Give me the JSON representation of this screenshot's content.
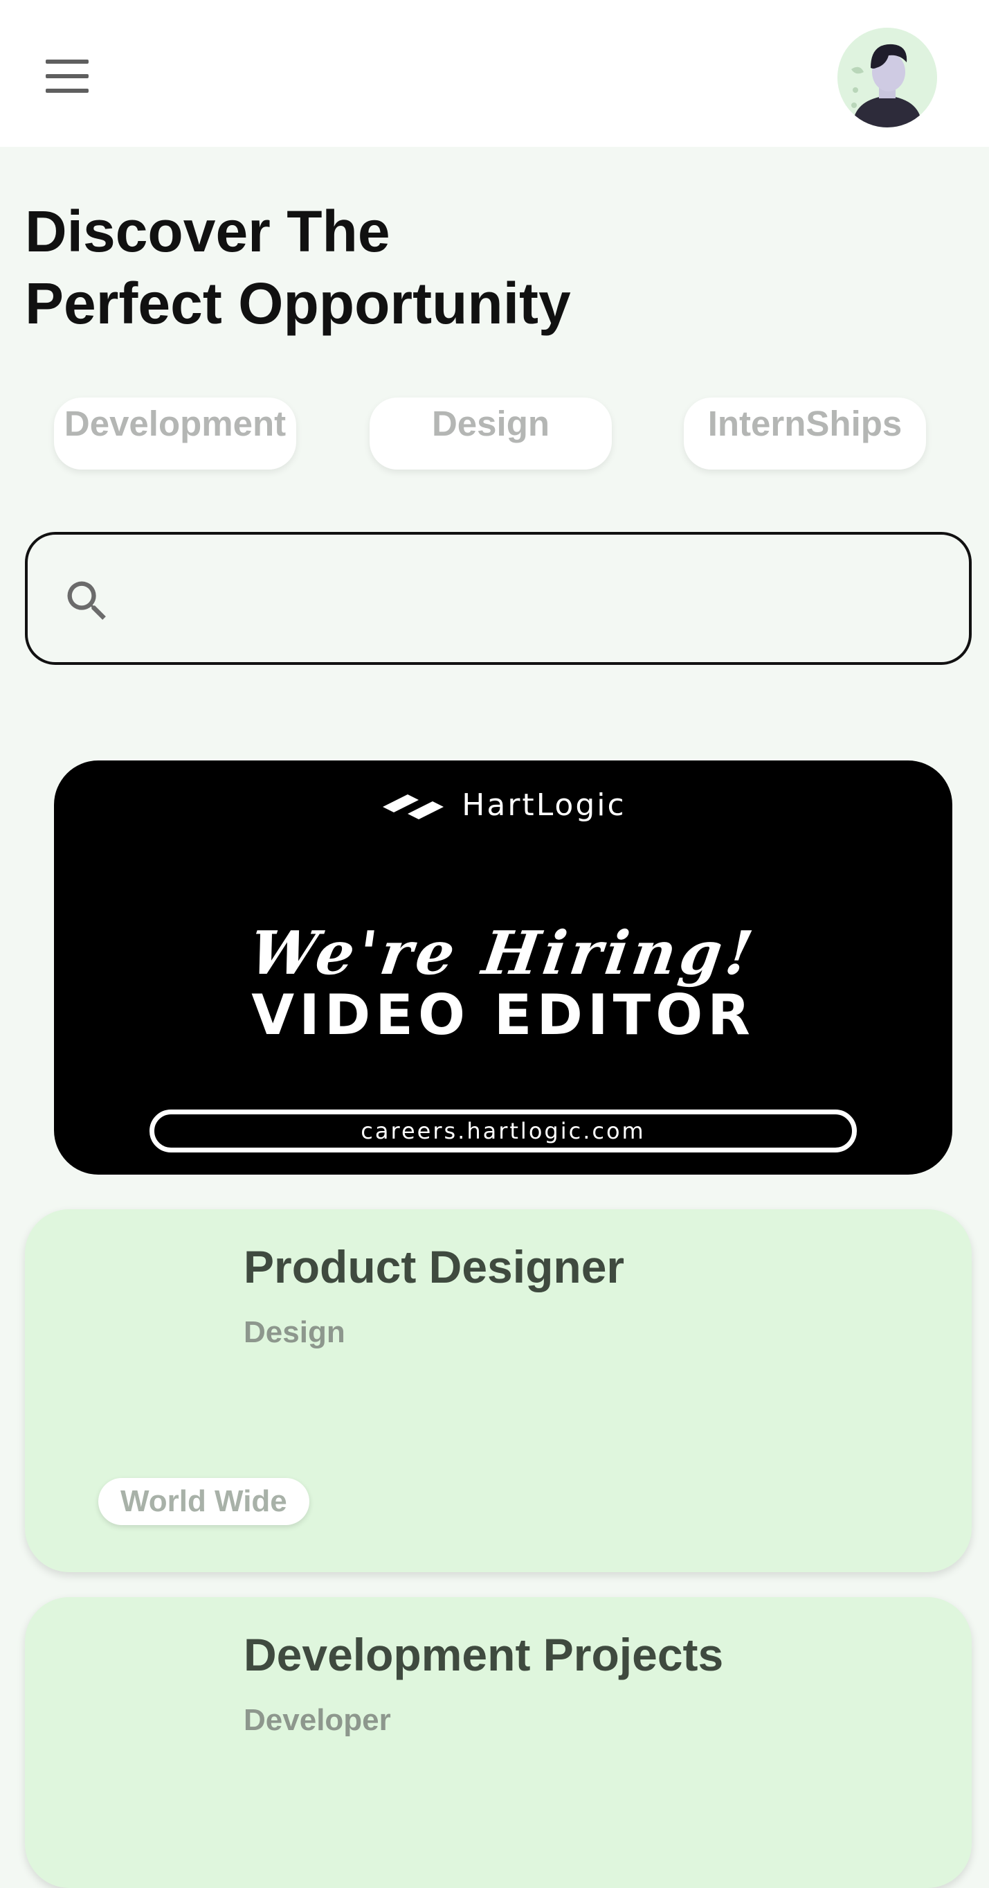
{
  "header": {
    "menu_icon": "hamburger-menu-icon",
    "avatar_icon": "user-avatar"
  },
  "hero": {
    "title_line1": "Discover The",
    "title_line2": "Perfect Opportunity"
  },
  "categories": [
    {
      "label": "Development"
    },
    {
      "label": "Design"
    },
    {
      "label": "InternShips"
    }
  ],
  "search": {
    "icon": "search-icon",
    "value": "",
    "placeholder": ""
  },
  "banner": {
    "brand": "HartLogic",
    "headline": "We're Hiring!",
    "role": "VIDEO EDITOR",
    "url": "careers.hartlogic.com"
  },
  "jobs": [
    {
      "title": "Product Designer",
      "category": "Design",
      "location": "World Wide"
    },
    {
      "title": "Development Projects",
      "category": "Developer"
    }
  ],
  "colors": {
    "page_background": "#f3f8f3",
    "card_background": "#dff6dd",
    "banner_background": "#000000",
    "chip_text": "#b4b6b4"
  }
}
